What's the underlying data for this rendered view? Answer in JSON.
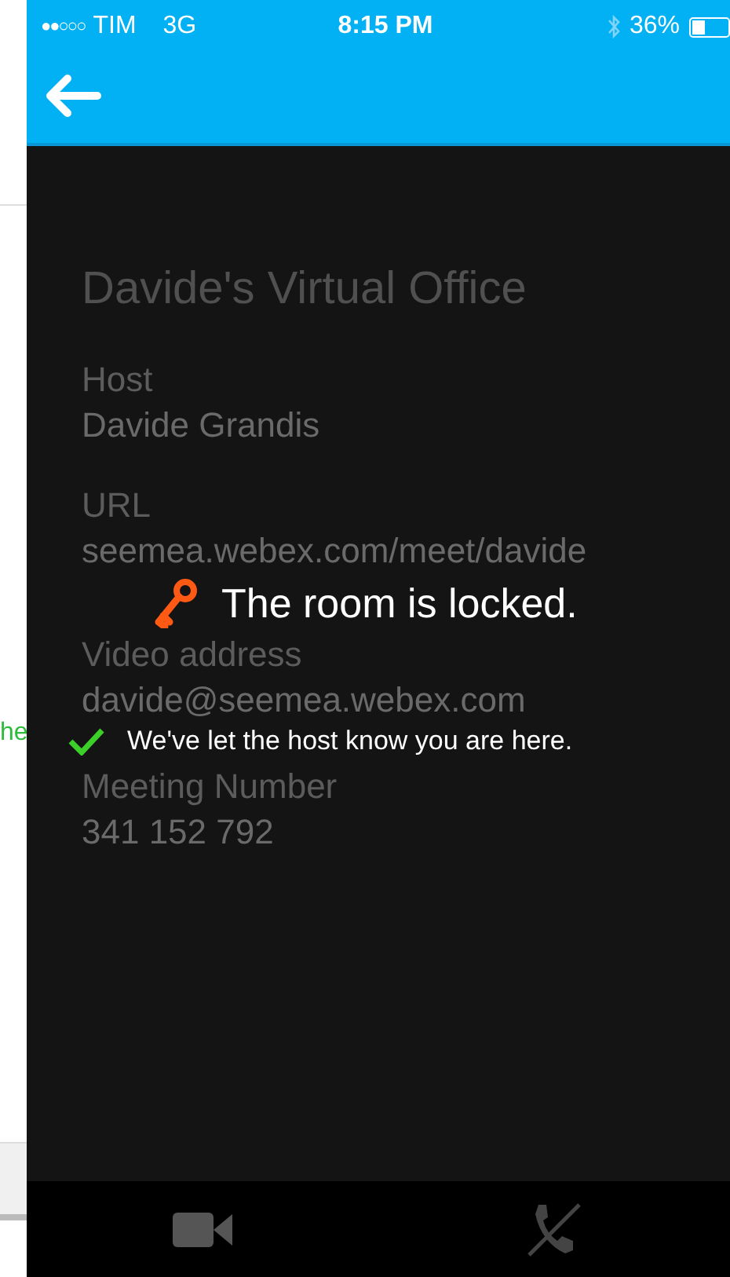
{
  "background_window": {
    "text_fragment": "he"
  },
  "status_bar": {
    "signal": "●●○○○",
    "carrier": "TIM",
    "network": "3G",
    "time": "8:15 PM",
    "battery": "36%"
  },
  "room": {
    "title": "Davide's Virtual Office",
    "fields": [
      {
        "label": "Host",
        "value": "Davide Grandis"
      },
      {
        "label": "URL",
        "value": "seemea.webex.com/meet/davide"
      },
      {
        "label": "Video address",
        "value": "davide@seemea.webex.com"
      },
      {
        "label": "Meeting Number",
        "value": "341 152 792"
      }
    ]
  },
  "lock_notice": {
    "message": "The room is locked.",
    "status": "We've let the host know you are here."
  },
  "toolbar": {
    "buttons": [
      {
        "kind": "video"
      },
      {
        "kind": "hangup"
      }
    ]
  }
}
